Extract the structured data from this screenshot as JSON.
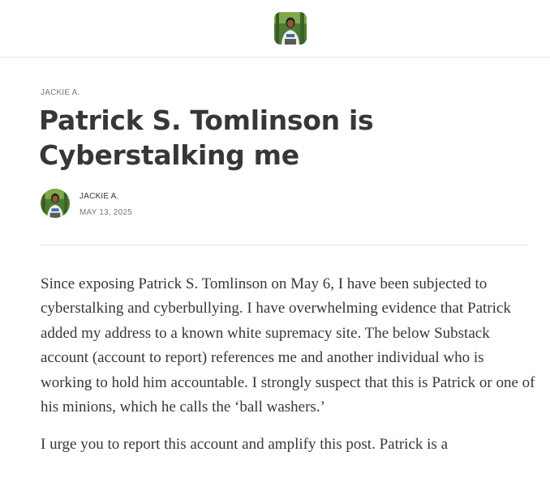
{
  "header": {
    "logo_icon": "author-avatar-icon"
  },
  "post": {
    "eyebrow": "JACKIE A.",
    "title": "Patrick S. Tomlinson is Cyberstalking me",
    "author": "JACKIE A.",
    "date": "MAY 13, 2025",
    "paragraphs": [
      "Since exposing Patrick S. Tomlinson on May 6, I have been subjected to cyberstalking and cyberbullying. I have overwhelming evidence that Patrick added my address to a known white supremacy site. The below Substack account (account to report) references me and another individual who is working to hold him accountable. I strongly suspect that this is Patrick or one of his minions, which he calls the ‘ball washers.’",
      "I urge you to report this account and amplify this post. Patrick is a"
    ]
  },
  "colors": {
    "text": "#363737",
    "muted": "#777777",
    "divider": "#e6e6e6",
    "background": "#ffffff"
  }
}
